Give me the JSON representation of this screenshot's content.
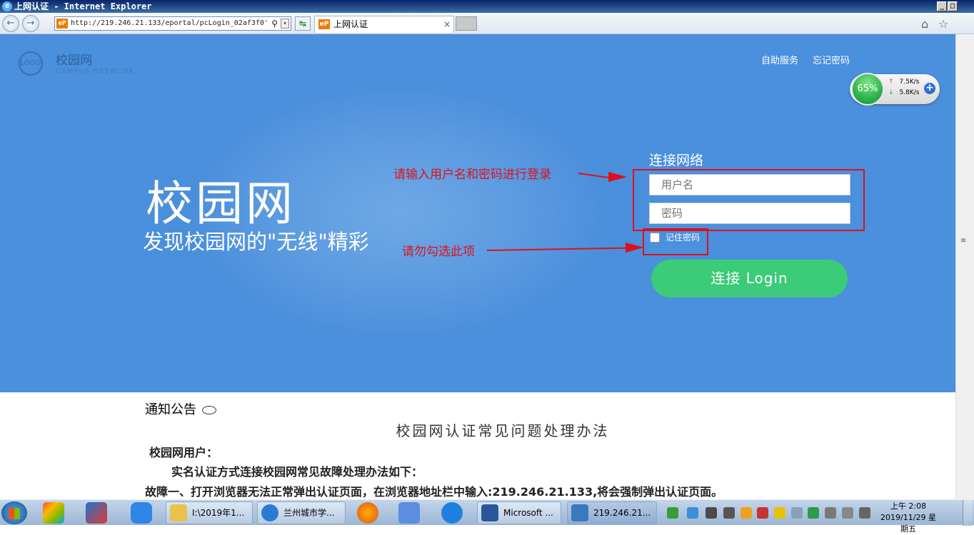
{
  "window": {
    "title": "上网认证 - Internet Explorer",
    "min_label": "_",
    "max_label": "□"
  },
  "browser": {
    "url": "http://219.246.21.133/eportal/pcLogin_02af3f0'",
    "tab_title": "上网认证",
    "tab_close": "×",
    "favicon_text": "eP",
    "back_glyph": "←",
    "forward_glyph": "→",
    "home_glyph": "⌂",
    "star_glyph": "☆",
    "search_glyph": "⚲",
    "dropdown_glyph": "▾",
    "refresh_glyph": "↹"
  },
  "portal": {
    "logo_text": "LOGO",
    "brand": "校园网",
    "brand_sub": "CAMPUS NETWORK",
    "links": [
      "自助服务",
      "忘记密码"
    ],
    "big_title": "校园网",
    "slogan": "发现校园网的\"无线\"精彩",
    "login_title": "连接网络",
    "username_placeholder": "用户名",
    "password_placeholder": "密码",
    "remember_label": "记住密码",
    "login_button": "连接 Login",
    "annotation_login": "请输入用户名和密码进行登录",
    "annotation_checkbox": "请勿勾选此项"
  },
  "speed_widget": {
    "percent": "65%",
    "upload": "7.5K/s",
    "download": "5.8K/s",
    "up_arrow": "↑",
    "down_arrow": "↓",
    "plus": "+"
  },
  "notice": {
    "heading": "通知公告",
    "doc_title": "校园网认证常见问题处理办法",
    "lines": [
      "校园网用户：",
      "实名认证方式连接校园网常见故障处理办法如下：",
      "故障一、打开浏览器无法正常弹出认证页面，在浏览器地址栏中输入:219.246.21.133,将会强制弹出认证页面。"
    ]
  },
  "scrollbar": {
    "grip": "≡"
  },
  "taskbar": {
    "tasks": [
      {
        "label": "I:\\2019年1..."
      },
      {
        "label": "兰州城市学..."
      },
      {
        "label": "Microsoft ..."
      },
      {
        "label": "219.246.21..."
      }
    ],
    "clock_time": "上午 2:08",
    "clock_date": "2019/11/29 星期五"
  },
  "colors": {
    "hero_blue": "#4a90dd",
    "login_green": "#3ccb78",
    "annotation_red": "#e0101a"
  }
}
